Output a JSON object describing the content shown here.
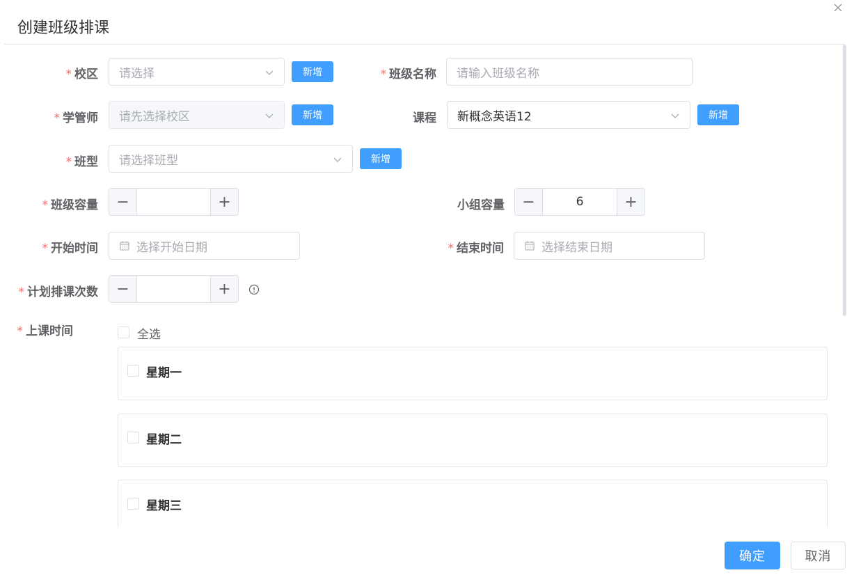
{
  "dialog": {
    "title": "创建班级排课",
    "confirm_label": "确定",
    "cancel_label": "取消"
  },
  "form": {
    "required_mark": "*",
    "campus": {
      "label": "校区",
      "placeholder": "请选择",
      "add_label": "新增"
    },
    "class_name": {
      "label": "班级名称",
      "placeholder": "请输入班级名称"
    },
    "manager": {
      "label": "学管师",
      "placeholder": "请先选择校区",
      "add_label": "新增"
    },
    "course": {
      "label": "课程",
      "value": "新概念英语12",
      "add_label": "新增"
    },
    "class_type": {
      "label": "班型",
      "placeholder": "请选择班型",
      "add_label": "新增"
    },
    "class_capacity": {
      "label": "班级容量",
      "value": ""
    },
    "group_capacity": {
      "label": "小组容量",
      "value": "6"
    },
    "start_time": {
      "label": "开始时间",
      "placeholder": "选择开始日期"
    },
    "end_time": {
      "label": "结束时间",
      "placeholder": "选择结束日期"
    },
    "plan_count": {
      "label": "计划排课次数",
      "value": ""
    },
    "class_time": {
      "label": "上课时间",
      "select_all": "全选",
      "days": [
        "星期一",
        "星期二",
        "星期三"
      ]
    }
  },
  "icons": {
    "close": "close-icon",
    "chevron": "chevron-down-icon",
    "calendar": "calendar-icon",
    "info": "info-icon"
  },
  "colors": {
    "primary": "#409eff",
    "required": "#f56c6c",
    "border": "#dcdfe6"
  }
}
